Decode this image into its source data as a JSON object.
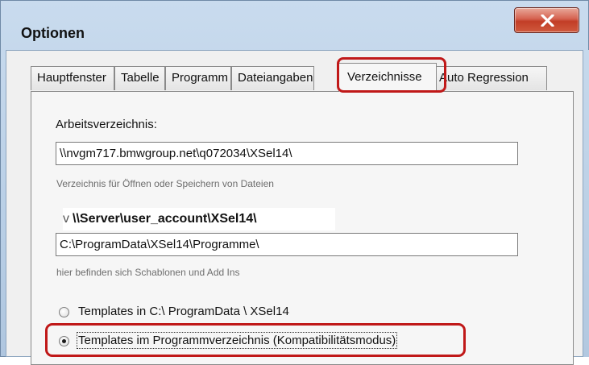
{
  "window": {
    "title": "Optionen",
    "close_icon": "close-icon"
  },
  "tabs": [
    {
      "label": "Hauptfenster",
      "active": false
    },
    {
      "label": "Tabelle",
      "active": false
    },
    {
      "label": "Programm",
      "active": false
    },
    {
      "label": "Dateiangaben",
      "active": false
    },
    {
      "label": "Verzeichnisse",
      "active": true
    },
    {
      "label": "Auto Regression",
      "active": false
    }
  ],
  "panel": {
    "work_dir_label": "Arbeitsverzeichnis:",
    "work_dir_value": "\\\\nvgm717.bmwgroup.net\\q072034\\XSel14\\",
    "work_dir_hint": "Verzeichnis für Öffnen oder Speichern von Dateien",
    "overlay_cut_char": "v",
    "overlay_text": "\\\\Server\\user_account\\XSel14\\",
    "program_dir_value": "C:\\ProgramData\\XSel14\\Programme\\",
    "program_dir_hint": "hier befinden sich Schablonen und Add Ins",
    "radio_options": [
      {
        "label": "Templates in C:\\ ProgramData \\ XSel14",
        "selected": false
      },
      {
        "label": "Templates im Programmverzeichnis (Kompatibilitätsmodus)",
        "selected": true
      }
    ]
  },
  "colors": {
    "highlight": "#c01818",
    "titlebar": "#c9dbee",
    "close_button": "#c23d26"
  }
}
